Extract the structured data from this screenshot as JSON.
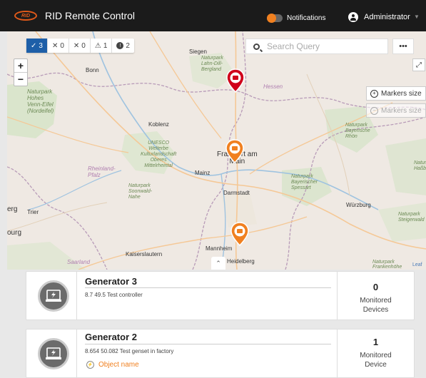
{
  "header": {
    "logo_text": "RID",
    "title": "RID Remote Control",
    "notifications_label": "Notifications",
    "user_label": "Administrator",
    "caret": "▼",
    "accent_color": "#f08020"
  },
  "filters": [
    {
      "glyph": "✓",
      "count": "3",
      "active": true
    },
    {
      "glyph": "✕",
      "count": "0",
      "active": false
    },
    {
      "glyph": "✕",
      "count": "0",
      "active": false
    },
    {
      "glyph": "⚠",
      "count": "1",
      "active": false
    },
    {
      "glyph": "!",
      "count": "2",
      "active": false
    }
  ],
  "search": {
    "placeholder": "Search Query"
  },
  "map_controls": {
    "zoom_in": "+",
    "zoom_out": "−",
    "more": "•••",
    "fullscreen": "⤢",
    "markers_size_increase": "Markers size",
    "markers_size_decrease": "Markers size",
    "plus_glyph": "+",
    "minus_glyph": "−",
    "collapse": "⌃",
    "attribution": "Leaf"
  },
  "map_labels": {
    "siegen": "Siegen",
    "bonn": "Bonn",
    "np_lahn": "Naturpark\nLahn-Dill-\nBergland",
    "np_hohes": "Naturpark\nHohes\nVenn-Eifel\n(Nordeifel)",
    "hessen": "Hessen",
    "koblenz": "Koblenz",
    "unesco": "UNESCO\nWelterbe\nKulturlandschaft\nOberes\nMittelrheintal",
    "np_rhoen": "Naturpark\nBayerische\nRhön",
    "frankfurt": "Frankfurt am\nMain",
    "mainz": "Mainz",
    "rheinland": "Rheinland-\nPfalz",
    "np_soonwald": "Naturpark\nSoonwald-\nNahe",
    "darmstadt": "Darmstadt",
    "np_spessart": "Naturpark\nBayerischer\nSpessart",
    "np_hassberge": "Natur\nHaßbe",
    "erg": "erg",
    "trier": "Trier",
    "wurzburg": "Würzburg",
    "np_steigerwald": "Naturpark\nSteigerwald",
    "ourg": "ourg",
    "mannheim": "Mannheim",
    "heidelberg": "Heidelberg",
    "kaiserslautern": "Kaiserslautern",
    "saarland": "Saarland",
    "np_frankenhohe": "Naturpark\nFrankenhöhe"
  },
  "devices": [
    {
      "name": "Generator 3",
      "description": "8.7 49.5 Test controller",
      "object_name": "",
      "monitored_count": "0",
      "monitored_label": "Monitored\nDevices"
    },
    {
      "name": "Generator 2",
      "description": "8.654 50.082 Test genset in factory",
      "object_name": "Object name",
      "monitored_count": "1",
      "monitored_label": "Monitored\nDevice"
    }
  ]
}
